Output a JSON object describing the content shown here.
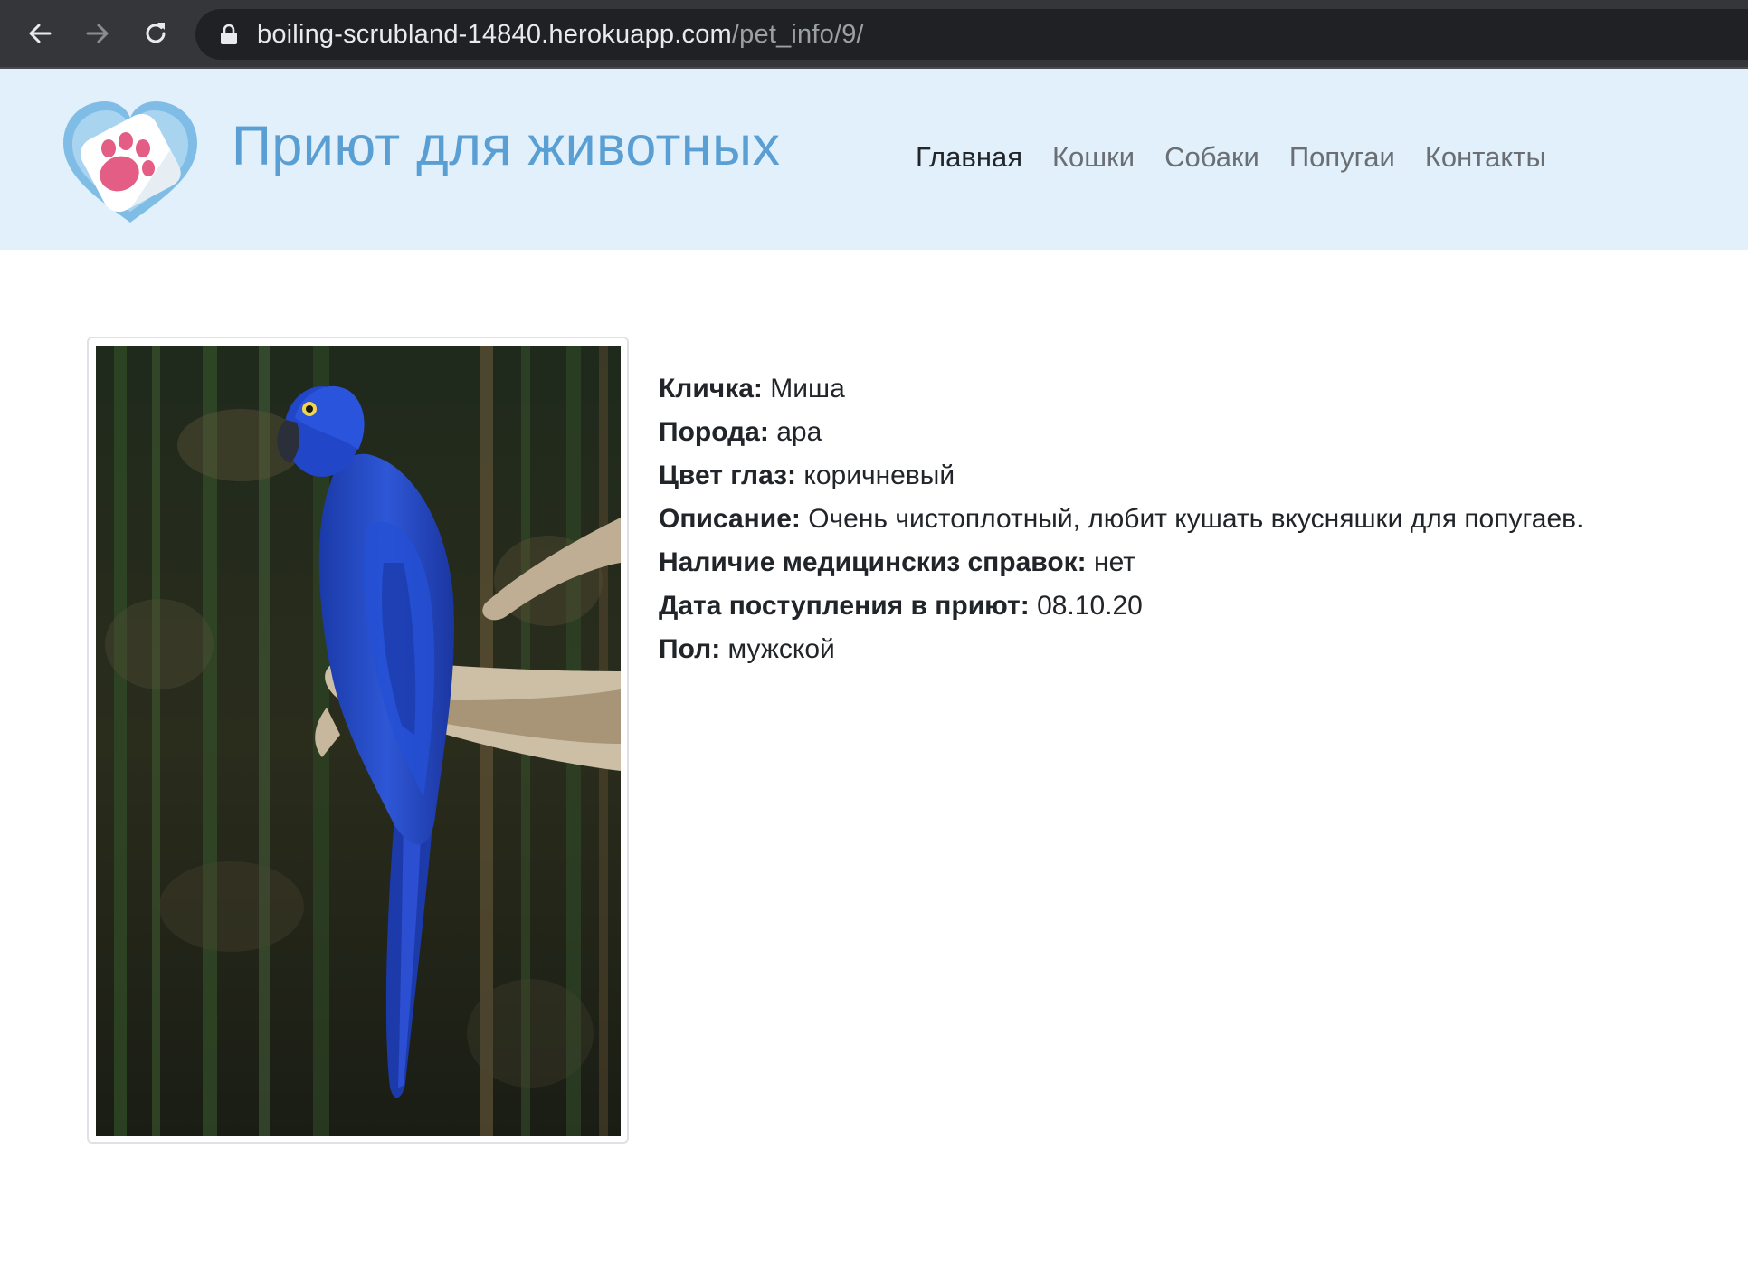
{
  "browser": {
    "url_host": "boiling-scrubland-14840.herokuapp.com",
    "url_path": "/pet_info/9/",
    "icons": [
      "back-arrow-icon",
      "forward-arrow-icon",
      "reload-icon",
      "lock-icon"
    ]
  },
  "header": {
    "title": "Приют для животных",
    "logo_icon": "heart-paw-icon",
    "nav": [
      {
        "label": "Главная",
        "active": true
      },
      {
        "label": "Кошки",
        "active": false
      },
      {
        "label": "Собаки",
        "active": false
      },
      {
        "label": "Попугаи",
        "active": false
      },
      {
        "label": "Контакты",
        "active": false
      }
    ]
  },
  "pet": {
    "photo_subject": "blue macaw parrot on branch",
    "fields": [
      {
        "label": "Кличка:",
        "value": "Миша"
      },
      {
        "label": "Порода:",
        "value": "ара"
      },
      {
        "label": "Цвет глаз:",
        "value": "коричневый"
      },
      {
        "label": "Описание:",
        "value": "Очень чистоплотный, любит кушать вкусняшки для попугаев."
      },
      {
        "label": "Наличие медицинскиз справок:",
        "value": "нет"
      },
      {
        "label": "Дата поступления в приют:",
        "value": "08.10.20"
      },
      {
        "label": "Пол:",
        "value": "мужской"
      }
    ]
  },
  "colors": {
    "header_bg": "#e1f0fb",
    "title": "#5a9fd4",
    "nav_active": "#222529",
    "nav_inactive": "#6b6f73",
    "macaw_blue": "#1f3fb8"
  }
}
